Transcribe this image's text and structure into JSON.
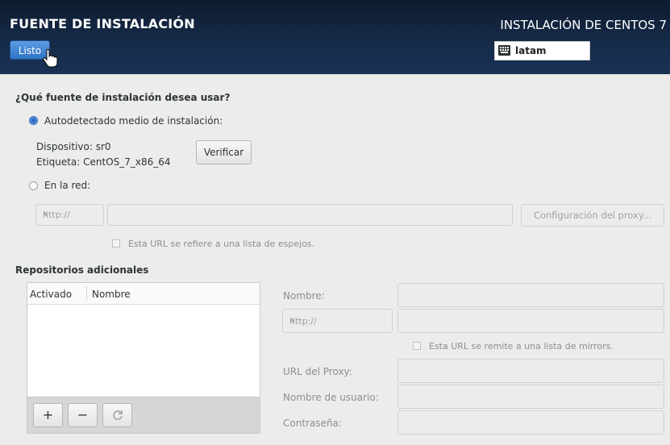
{
  "header": {
    "spoke_title": "FUENTE DE INSTALACIÓN",
    "product_title": "INSTALACIÓN DE CENTOS 7",
    "done_label": "Listo",
    "keyboard_layout": "latam"
  },
  "source": {
    "question": "¿Qué fuente de instalación desea usar?",
    "auto_option": "Autodetectado medio de instalación:",
    "auto_selected": true,
    "device_line": "Dispositivo: sr0",
    "label_line": "Etiqueta: CentOS_7_x86_64",
    "verify_label": "Verificar",
    "network_option": "En la red:",
    "network_selected": false,
    "protocol_value": "http://",
    "url_value": "",
    "proxy_button": "Configuración del proxy...",
    "mirror_checkbox": "Esta URL se refiere a una lista de espejos.",
    "mirror_checked": false
  },
  "repos": {
    "section_title": "Repositorios adicionales",
    "columns": [
      "Activado",
      "Nombre"
    ],
    "rows": [],
    "add_label": "+",
    "remove_label": "−",
    "refresh_icon": "refresh-icon",
    "form": {
      "name_label": "Nombre:",
      "name_value": "",
      "protocol_value": "http://",
      "url_value": "",
      "mirror_checkbox": "Esta URL se remite a una lista de mirrors.",
      "mirror_checked": false,
      "proxy_url_label": "URL del Proxy:",
      "username_label": "Nombre de usuario:",
      "password_label": "Contraseña:"
    }
  },
  "colors": {
    "header_bg": "#152a48",
    "accent": "#3b7cd6"
  }
}
